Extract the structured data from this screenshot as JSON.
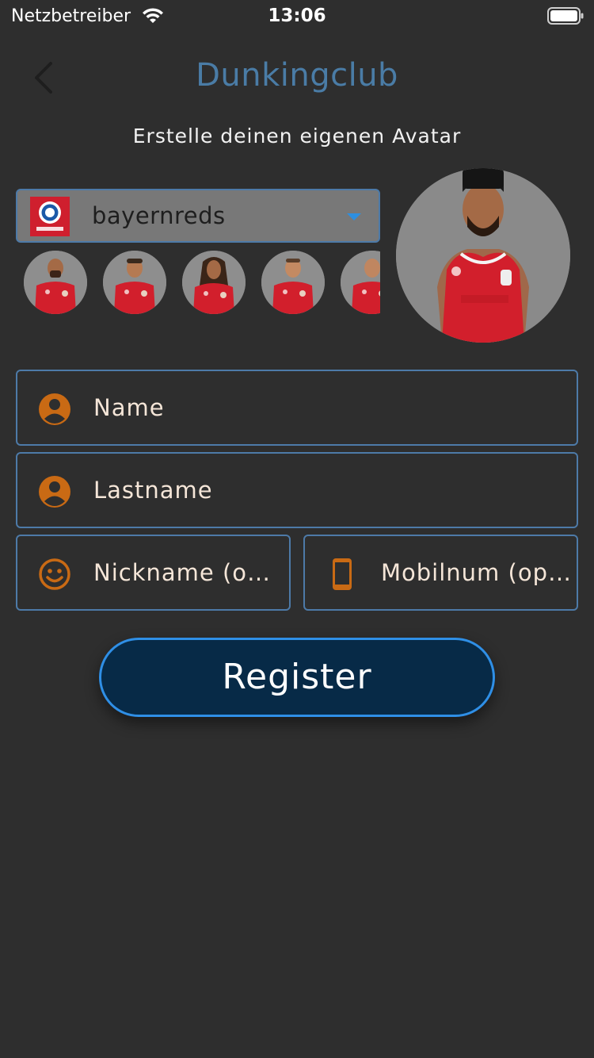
{
  "status_bar": {
    "carrier": "Netzbetreiber",
    "time": "13:06",
    "wifi_icon": "wifi-icon",
    "battery_icon": "battery-icon"
  },
  "nav": {
    "title": "Dunkingclub",
    "back_icon": "chevron-left-icon"
  },
  "subtitle": "Erstelle deinen eigenen Avatar",
  "team_select": {
    "selected": "bayernreds",
    "logo_icon": "team-logo",
    "arrow_icon": "dropdown-arrow-icon"
  },
  "avatars": {
    "count_visible": 5,
    "selected_preview": "avatar-preview"
  },
  "form": {
    "name_placeholder": "Name",
    "lastname_placeholder": "Lastname",
    "nickname_placeholder": "Nickname (optional)",
    "mobile_placeholder": "Mobilnum (optional)",
    "icons": {
      "name": "person-icon",
      "lastname": "person-icon",
      "nickname": "smiley-icon",
      "mobile": "phone-icon"
    }
  },
  "register_label": "Register",
  "colors": {
    "background": "#2e2e2e",
    "accent_blue": "#4d7aa8",
    "title_blue": "#4a7ca6",
    "icon_orange": "#c96a14",
    "button_bg": "#072a47",
    "button_border": "#2f8fe6",
    "jersey_red": "#d21f2c"
  }
}
